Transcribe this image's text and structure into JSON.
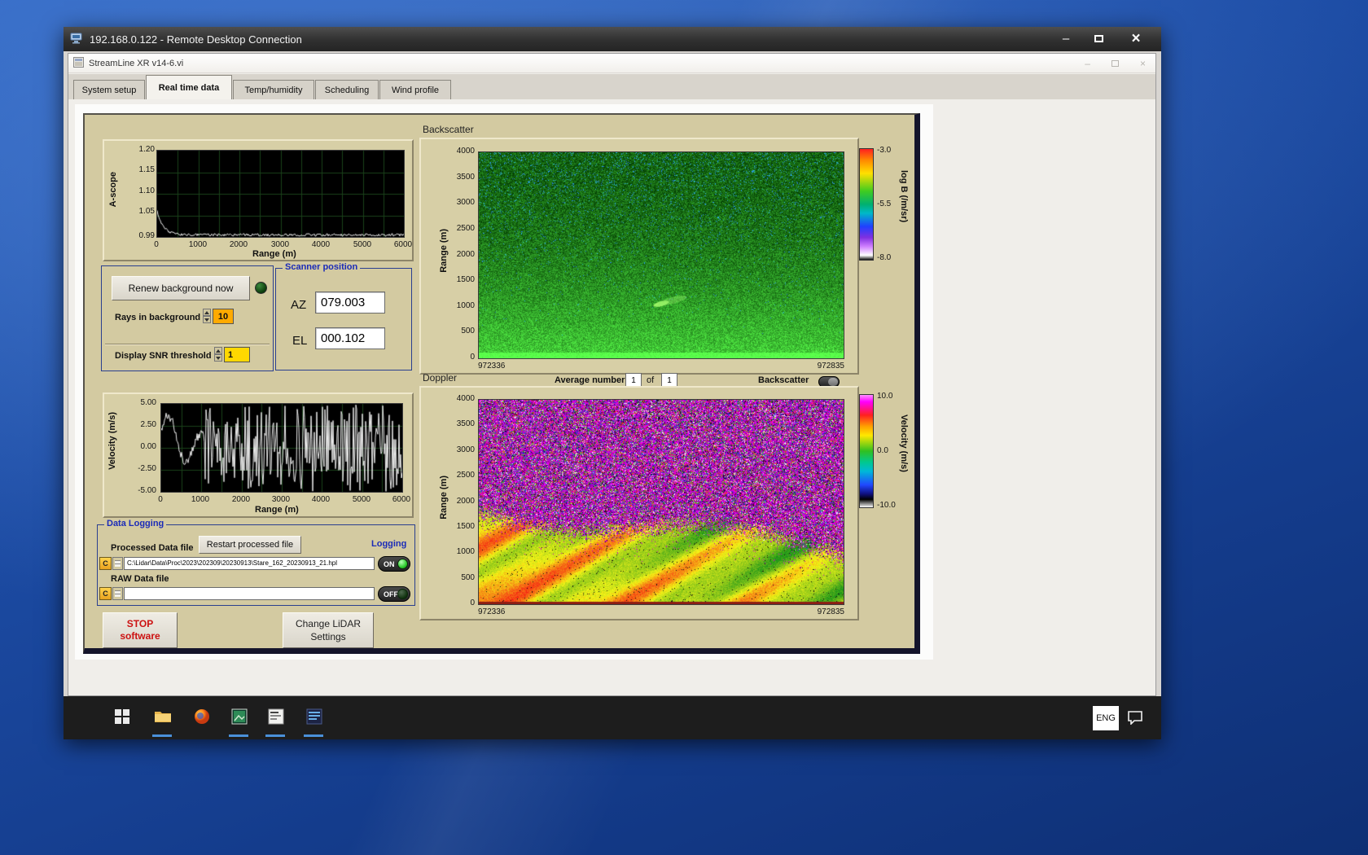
{
  "rdp": {
    "title": "192.168.0.122 - Remote Desktop Connection"
  },
  "app": {
    "title": "StreamLine XR v14-6.vi",
    "tabs": [
      {
        "label": "System setup"
      },
      {
        "label": "Real time data"
      },
      {
        "label": "Temp/humidity"
      },
      {
        "label": "Scheduling"
      },
      {
        "label": "Wind profile"
      }
    ]
  },
  "controls": {
    "renew_button": "Renew background now",
    "rays_label": "Rays in background",
    "rays_value": "10",
    "snr_label": "Display SNR threshold",
    "snr_value": "1",
    "scanner": {
      "title": "Scanner position",
      "az_label": "AZ",
      "az_value": "079.003",
      "el_label": "EL",
      "el_value": "000.102"
    },
    "average": {
      "label": "Average number",
      "first": "1",
      "of": "of",
      "second": "1"
    },
    "backscatter_switch_label": "Backscatter",
    "stop_line1": "STOP",
    "stop_line2": "software",
    "change_line1": "Change LiDAR",
    "change_line2": "Settings"
  },
  "logging": {
    "title": "Data Logging",
    "processed_label": "Processed Data file",
    "restart_button": "Restart processed file",
    "logging_label": "Logging",
    "drive": "C",
    "processed_path": "C:\\Lidar\\Data\\Proc\\2023\\202309\\20230913\\Stare_162_20230913_21.hpl",
    "on": "ON",
    "raw_label": "RAW Data file",
    "raw_path": "",
    "off": "OFF"
  },
  "taskbar": {
    "language": "ENG"
  },
  "colors": {
    "panel": "#d3caa1",
    "group_border": "#2a3f8f",
    "group_title_blue": "#1b2bb8",
    "rays_box": "#ffaa00",
    "snr_box": "#ffd800",
    "stop_red": "#cc1111",
    "on_lamp_green": "#2ecc2e"
  },
  "chart_data": [
    {
      "id": "ascope",
      "type": "line",
      "title": "",
      "xlabel": "Range (m)",
      "ylabel": "A-scope",
      "x_ticks": [
        "0",
        "1000",
        "2000",
        "3000",
        "4000",
        "5000",
        "6000"
      ],
      "y_ticks": [
        "1.20",
        "1.15",
        "1.10",
        "1.05",
        "0.99"
      ],
      "xlim": [
        0,
        6000
      ],
      "ylim": [
        0.99,
        1.2
      ],
      "grid": true,
      "series": [
        {
          "name": "a-scope",
          "description": "white trace starting near 1.05 at range 0, decaying to ~0.99 by ~500 m, then flat with small noise out to 6000 m"
        }
      ]
    },
    {
      "id": "backscatter",
      "type": "heatmap",
      "title": "Backscatter",
      "ylabel": "Range (m)",
      "y_ticks": [
        "4000",
        "3500",
        "3000",
        "2500",
        "2000",
        "1500",
        "1000",
        "500",
        "0"
      ],
      "x_start_label": "972336",
      "x_end_label": "972835",
      "colorbar": {
        "label": "log B (/m/sr)",
        "ticks": [
          "-3.0",
          "-5.5",
          "-8.0"
        ]
      },
      "description": "green speckle-noise backscatter field, dim at high range, brightening toward 0 m with a bright green line at the surface and a small bright echo near 1000 m mid-record; sparse blue/teal speckles at upper ranges"
    },
    {
      "id": "velocity",
      "type": "line",
      "title": "",
      "xlabel": "Range (m)",
      "ylabel": "Velocity (m/s)",
      "x_ticks": [
        "0",
        "1000",
        "2000",
        "3000",
        "4000",
        "5000",
        "6000"
      ],
      "y_ticks": [
        "5.00",
        "2.50",
        "0.00",
        "-2.50",
        "-5.00"
      ],
      "xlim": [
        0,
        6000
      ],
      "ylim": [
        -5,
        5
      ],
      "grid": true,
      "series": [
        {
          "name": "velocity",
          "description": "smooth wave between about -3 and +4 m/s below ~1100 m, then saturated random oscillation spanning -5 to +5 m/s (dense vertical hash) out to 6000 m"
        }
      ]
    },
    {
      "id": "doppler",
      "type": "heatmap",
      "title": "Doppler",
      "ylabel": "Range (m)",
      "y_ticks": [
        "4000",
        "3500",
        "3000",
        "2500",
        "2000",
        "1500",
        "1000",
        "500",
        "0"
      ],
      "x_start_label": "972336",
      "x_end_label": "972835",
      "colorbar": {
        "label": "Velocity (m/s)",
        "ticks": [
          "10.0",
          "0.0",
          "-10.0"
        ]
      },
      "description": "magenta/purple/black random noise above the aerosol layer; below ~1000-1800 m (boundary sloping down to the right) a smooth velocity field of green with diagonal yellow and red streaks, strongest red near the bottom-left, thin dark-red line at 0 m"
    }
  ]
}
